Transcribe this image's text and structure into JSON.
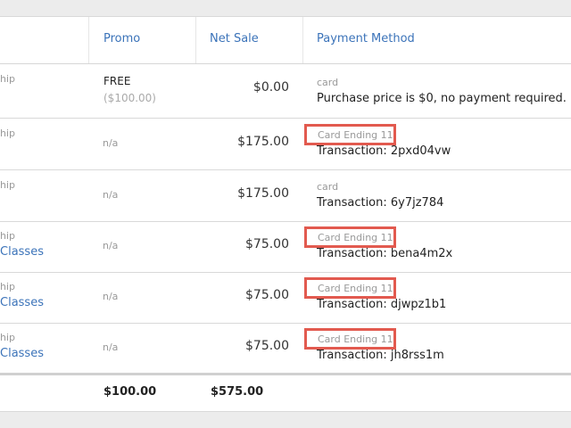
{
  "header": {
    "promo": "Promo",
    "net_sale": "Net Sale",
    "payment_method": "Payment Method"
  },
  "rows": [
    {
      "left_top": "hip",
      "left_bottom": "",
      "promo_main": "FREE",
      "promo_sub": "($100.00)",
      "net": "$0.00",
      "pm_small": "card",
      "pm_main": "Purchase price is $0, no payment required.",
      "highlight": false
    },
    {
      "left_top": "hip",
      "left_bottom": "",
      "promo": "n/a",
      "net": "$175.00",
      "pm_small": "Card Ending 11",
      "pm_main": "Transaction: 2pxd04vw",
      "highlight": true
    },
    {
      "left_top": "hip",
      "left_bottom": "",
      "promo": "n/a",
      "net": "$175.00",
      "pm_small": "card",
      "pm_main": "Transaction: 6y7jz784",
      "highlight": false
    },
    {
      "left_top": "hip",
      "left_bottom": "Classes",
      "promo": "n/a",
      "net": "$75.00",
      "pm_small": "Card Ending 11",
      "pm_main": "Transaction: bena4m2x",
      "highlight": true
    },
    {
      "left_top": "hip",
      "left_bottom": "Classes",
      "promo": "n/a",
      "net": "$75.00",
      "pm_small": "Card Ending 11",
      "pm_main": "Transaction: djwpz1b1",
      "highlight": true
    },
    {
      "left_top": "hip",
      "left_bottom": "Classes",
      "promo": "n/a",
      "net": "$75.00",
      "pm_small": "Card Ending 11",
      "pm_main": "Transaction: jh8rss1m",
      "highlight": true
    }
  ],
  "totals": {
    "promo": "$100.00",
    "net": "$575.00"
  },
  "colors": {
    "link": "#3b73b9",
    "highlight": "#e25a4f"
  }
}
